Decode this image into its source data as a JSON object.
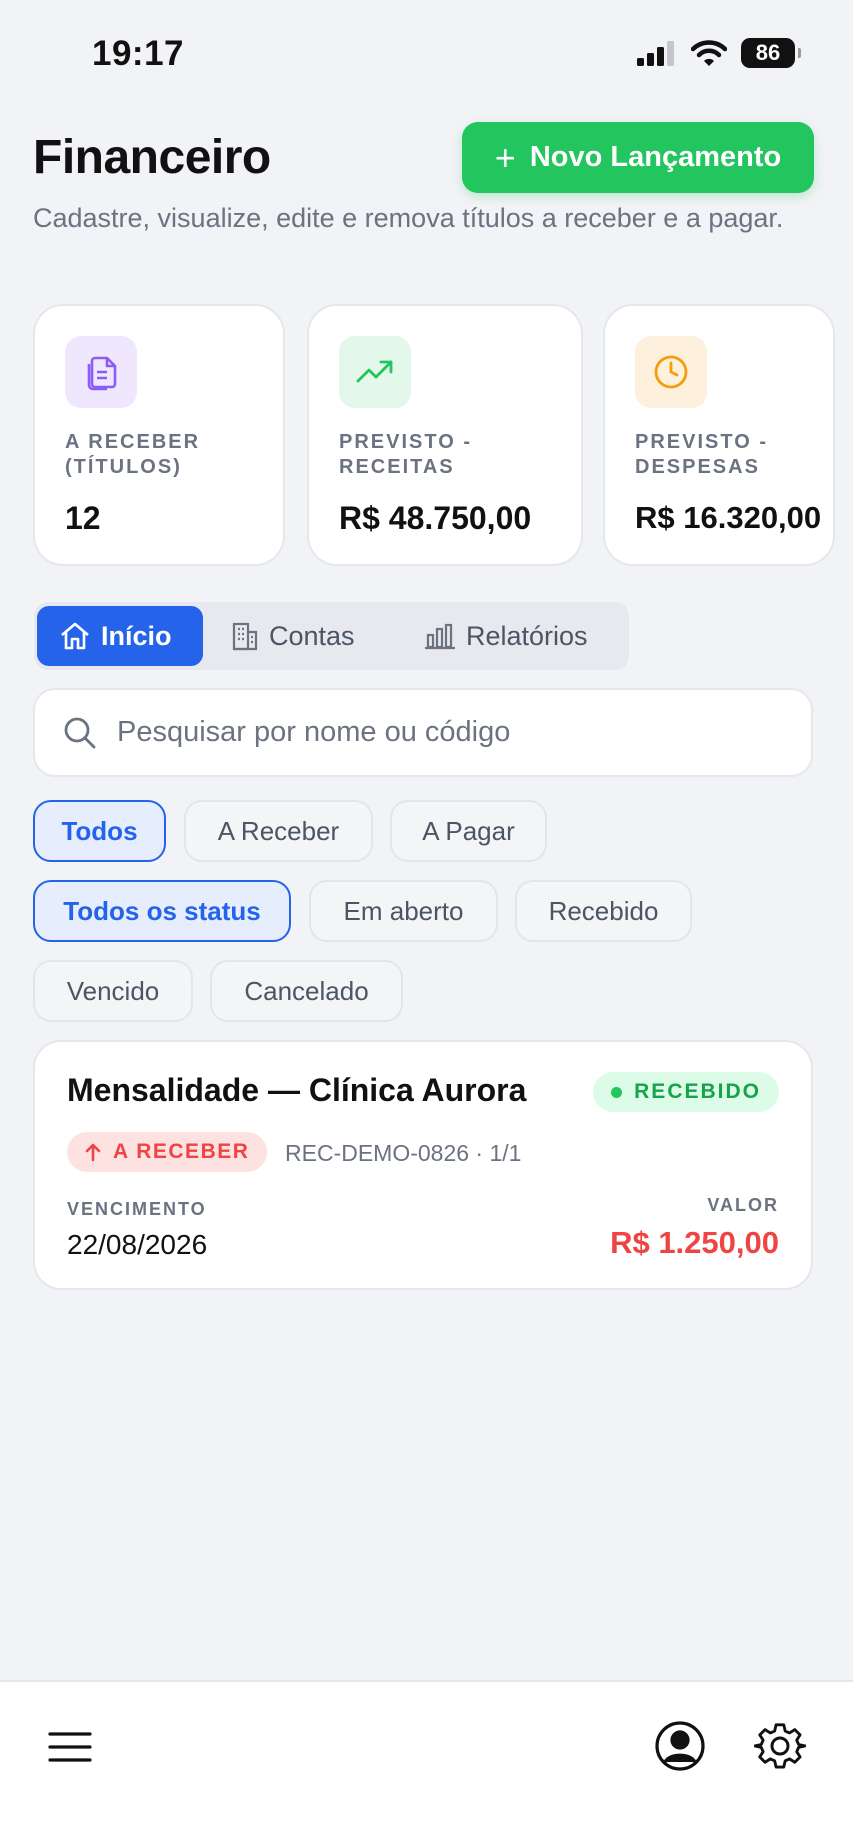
{
  "status_bar": {
    "time": "19:17",
    "battery": "86"
  },
  "header": {
    "title": "Financeiro",
    "subtitle": "Cadastre, visualize, edite e remova títulos a receber e a pagar.",
    "new_button": "Novo Lançamento"
  },
  "summary_cards": [
    {
      "label_line1": "A RECEBER",
      "label_line2": "(TÍTULOS)",
      "value": "12",
      "icon": "documents-icon",
      "color": "#8b5cf6"
    },
    {
      "label_line1": "PREVISTO -",
      "label_line2": "RECEITAS",
      "value": "R$ 48.750,00",
      "icon": "trending-up-icon",
      "color": "#22c55e"
    },
    {
      "label_line1": "PREVISTO -",
      "label_line2": "DESPESAS",
      "value": "R$ 16.320,00",
      "icon": "clock-icon",
      "color": "#f59e0b"
    }
  ],
  "tabs": [
    {
      "label": "Início",
      "icon": "home-icon",
      "active": true
    },
    {
      "label": "Contas",
      "icon": "building-icon",
      "active": false
    },
    {
      "label": "Relatórios",
      "icon": "bar-chart-icon",
      "active": false
    }
  ],
  "search": {
    "placeholder": "Pesquisar por nome ou código"
  },
  "type_filters": [
    {
      "label": "Todos",
      "selected": true
    },
    {
      "label": "A Receber",
      "selected": false
    },
    {
      "label": "A Pagar",
      "selected": false
    }
  ],
  "status_filters": [
    {
      "label": "Todos os status",
      "selected": true
    },
    {
      "label": "Em aberto",
      "selected": false
    },
    {
      "label": "Recebido",
      "selected": false
    },
    {
      "label": "Vencido",
      "selected": false
    },
    {
      "label": "Cancelado",
      "selected": false
    }
  ],
  "entries": [
    {
      "title": "Mensalidade — Clínica Aurora",
      "status": "RECEBIDO",
      "type": "A RECEBER",
      "code": "REC-DEMO-0826 · 1/1",
      "due_label": "VENCIMENTO",
      "due_date": "22/08/2026",
      "amount_label": "VALOR",
      "amount": "R$ 1.250,00"
    }
  ],
  "bottom_bar": {
    "left_icon": "menu-icon",
    "right_icons": [
      "user-circle-icon",
      "gear-icon"
    ]
  },
  "colors": {
    "primary": "#2563eb",
    "success": "#22c55e",
    "danger": "#ef4444",
    "warning": "#f59e0b",
    "purple": "#8b5cf6"
  }
}
